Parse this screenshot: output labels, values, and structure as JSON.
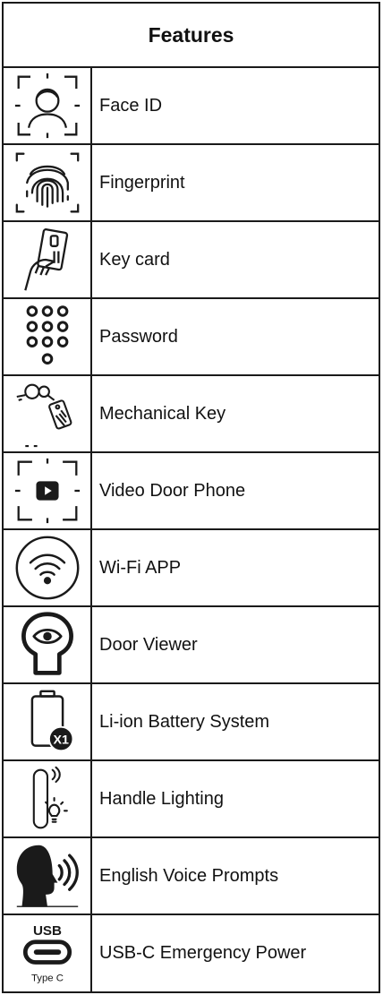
{
  "header": {
    "title": "Features"
  },
  "features": [
    {
      "label": "Face ID",
      "icon": "face-id-icon"
    },
    {
      "label": "Fingerprint",
      "icon": "fingerprint-icon"
    },
    {
      "label": "Key card",
      "icon": "key-card-icon"
    },
    {
      "label": "Password",
      "icon": "keypad-icon"
    },
    {
      "label": "Mechanical Key",
      "icon": "mechanical-key-icon"
    },
    {
      "label": "Video Door Phone",
      "icon": "video-door-phone-icon"
    },
    {
      "label": "Wi-Fi APP",
      "icon": "wifi-icon"
    },
    {
      "label": "Door Viewer",
      "icon": "door-viewer-icon"
    },
    {
      "label": "Li-ion Battery System",
      "icon": "battery-icon"
    },
    {
      "label": "Handle Lighting",
      "icon": "handle-lighting-icon"
    },
    {
      "label": "English Voice Prompts",
      "icon": "voice-prompts-icon"
    },
    {
      "label": "USB-C Emergency Power",
      "icon": "usb-c-icon"
    }
  ],
  "icon_text": {
    "usb": "USB",
    "type_c": "Type C",
    "battery_badge": "X1"
  },
  "colors": {
    "border": "#1a1a1a",
    "icon": "#1a1a1a"
  }
}
